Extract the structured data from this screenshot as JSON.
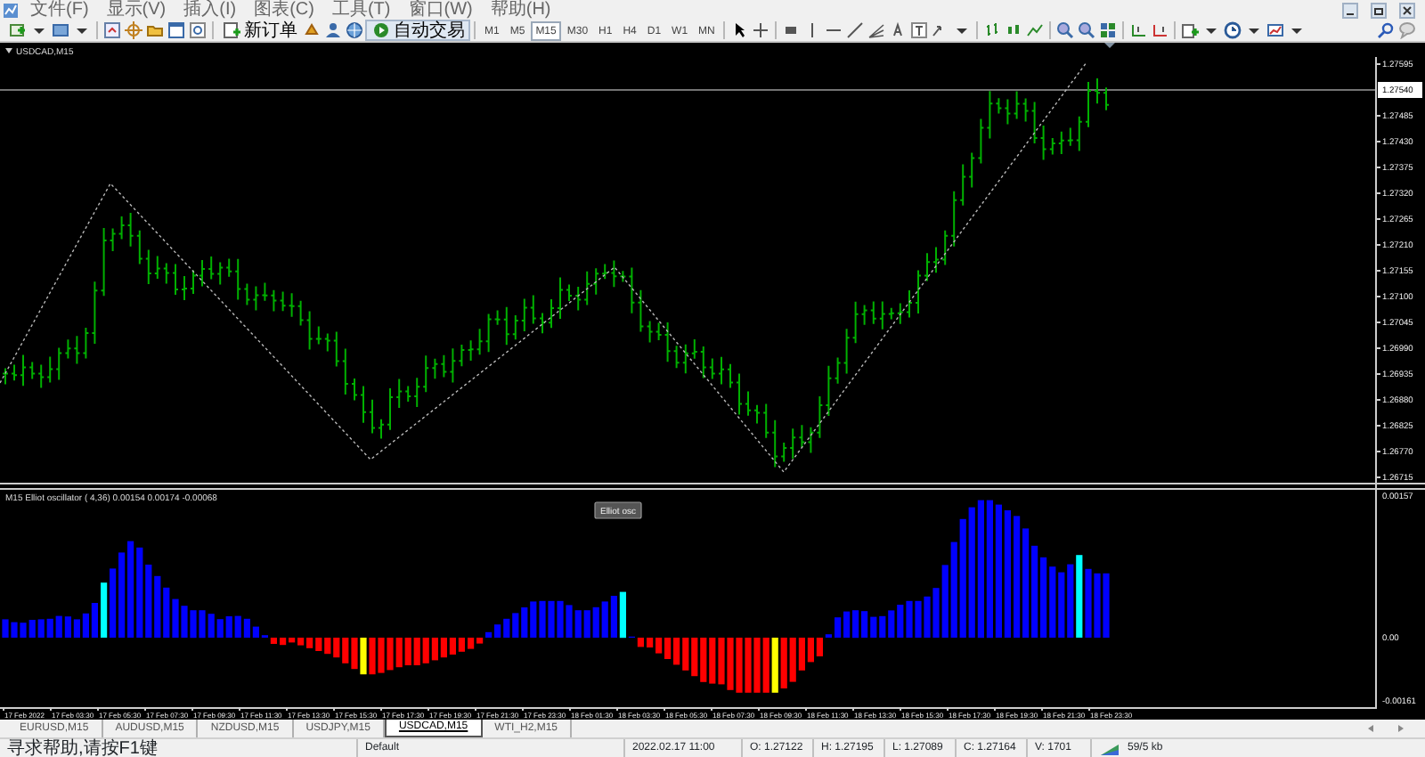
{
  "menu": [
    {
      "label": "文件(F)"
    },
    {
      "label": "显示(V)"
    },
    {
      "label": "插入(I)"
    },
    {
      "label": "图表(C)"
    },
    {
      "label": "工具(T)"
    },
    {
      "label": "窗口(W)"
    },
    {
      "label": "帮助(H)"
    }
  ],
  "toolbar": {
    "order_button": "新订单",
    "autotrade_button": "自动交易",
    "timeframes": [
      {
        "label": "M1",
        "selected": false
      },
      {
        "label": "M5",
        "selected": false
      },
      {
        "label": "M15",
        "selected": true
      },
      {
        "label": "M30",
        "selected": false
      },
      {
        "label": "H1",
        "selected": false
      },
      {
        "label": "H4",
        "selected": false
      },
      {
        "label": "D1",
        "selected": false
      },
      {
        "label": "W1",
        "selected": false
      },
      {
        "label": "MN",
        "selected": false
      }
    ]
  },
  "chart": {
    "title": "USDCAD,M15",
    "price_axis": [
      "1.27595",
      "1.27485",
      "1.27430",
      "1.27375",
      "1.27320",
      "1.27265",
      "1.27210",
      "1.27155",
      "1.27100",
      "1.27045",
      "1.26990",
      "1.26935",
      "1.26880",
      "1.26825",
      "1.26770",
      "1.26715"
    ],
    "current_price": "1.27540",
    "indicator": {
      "label": "M15 Elliot oscillator ( 4,36) 0.00154 0.00174 -0.00068",
      "button": "Elliot osc",
      "axis": [
        "0.00157",
        "0.00",
        "-0.00161"
      ]
    },
    "time_axis": [
      "17 Feb 2022",
      "17 Feb 03:30",
      "17 Feb 05:30",
      "17 Feb 07:30",
      "17 Feb 09:30",
      "17 Feb 11:30",
      "17 Feb 13:30",
      "17 Feb 15:30",
      "17 Feb 17:30",
      "17 Feb 19:30",
      "17 Feb 21:30",
      "17 Feb 23:30",
      "18 Feb 01:30",
      "18 Feb 03:30",
      "18 Feb 05:30",
      "18 Feb 07:30",
      "18 Feb 09:30",
      "18 Feb 11:30",
      "18 Feb 13:30",
      "18 Feb 15:30",
      "18 Feb 17:30",
      "18 Feb 19:30",
      "18 Feb 21:30",
      "18 Feb 23:30"
    ]
  },
  "tabs": [
    {
      "label": "EURUSD,M15",
      "selected": false
    },
    {
      "label": "AUDUSD,M15",
      "selected": false
    },
    {
      "label": "NZDUSD,M15",
      "selected": false
    },
    {
      "label": "USDJPY,M15",
      "selected": false
    },
    {
      "label": "USDCAD,M15",
      "selected": true
    },
    {
      "label": "WTI_H2,M15",
      "selected": false
    }
  ],
  "status_bar": {
    "help": "寻求帮助,请按F1键",
    "profile": "Default",
    "time": "2022.02.17 11:00",
    "open": "O: 1.27122",
    "high": "H: 1.27195",
    "low": "L: 1.27089",
    "close": "C: 1.27164",
    "volume": "V: 1701",
    "traffic": "59/5 kb"
  }
}
